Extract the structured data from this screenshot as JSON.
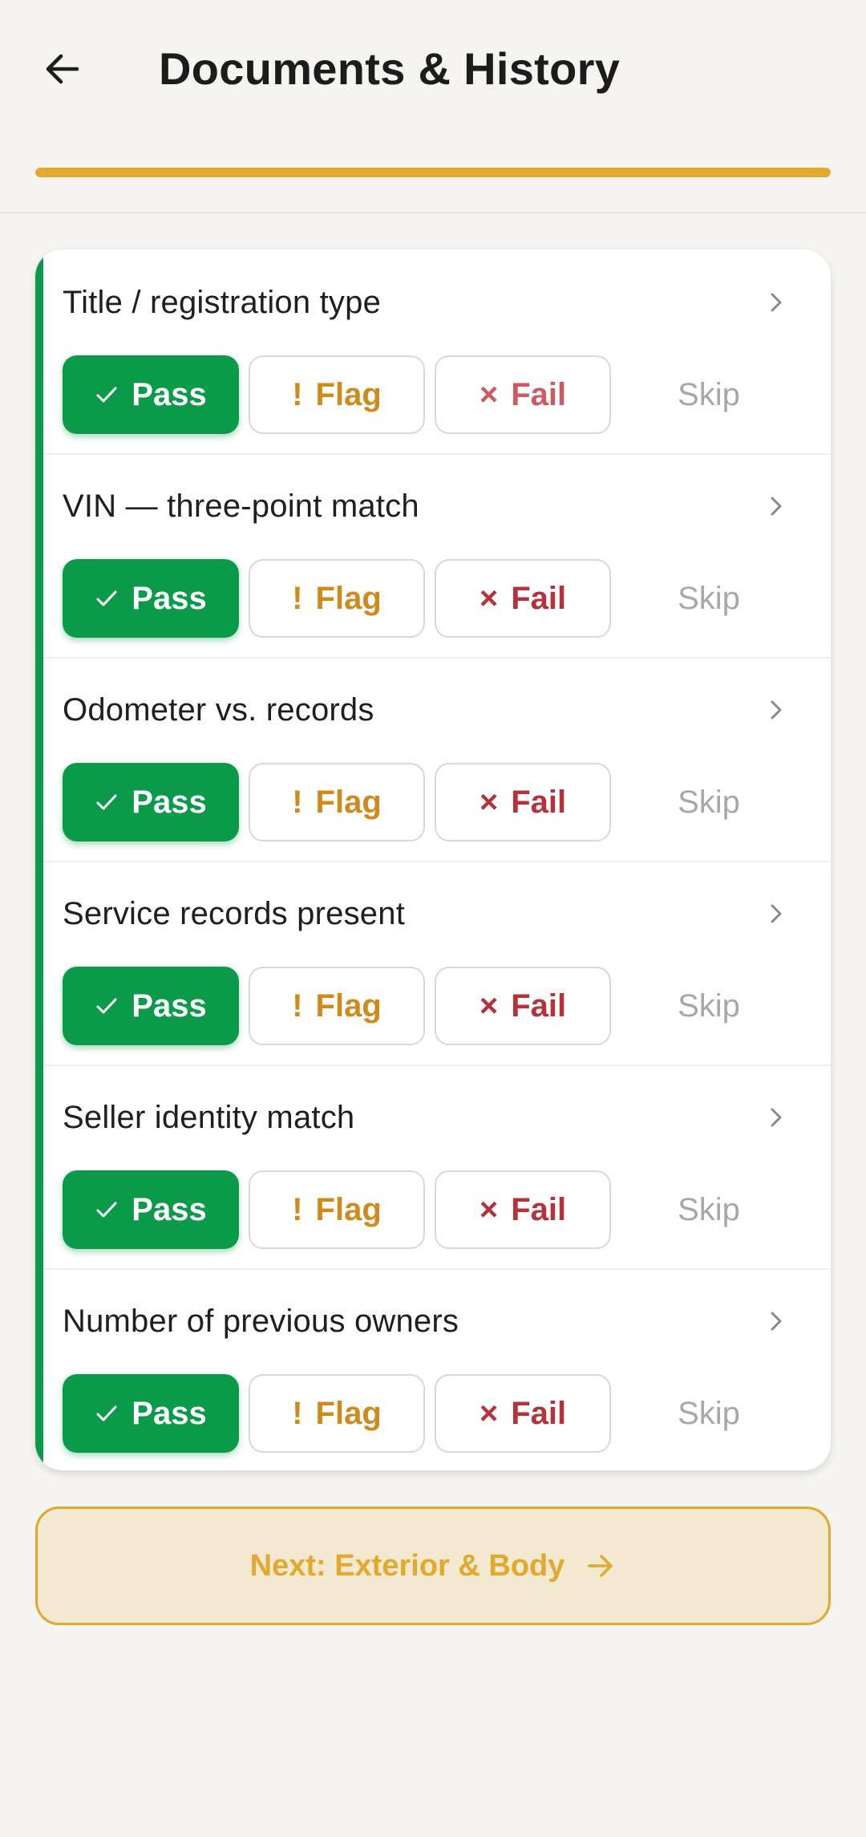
{
  "header": {
    "title": "Documents & History",
    "back_icon": "arrow-left-icon",
    "progress_fraction": 1.0,
    "progress_color": "#e2a92e"
  },
  "checklist": {
    "accent_color": "#0b9a4a",
    "items": [
      {
        "label": "Title / registration type",
        "selected": "pass",
        "pass_label": "Pass",
        "flag_label": "Flag",
        "fail_label": "Fail",
        "skip_label": "Skip",
        "flag_glyph": "!",
        "fail_glyph": "×"
      },
      {
        "label": "VIN — three-point match",
        "selected": "pass",
        "pass_label": "Pass",
        "flag_label": "Flag",
        "fail_label": "Fail",
        "skip_label": "Skip",
        "flag_glyph": "!",
        "fail_glyph": "×"
      },
      {
        "label": "Odometer vs. records",
        "selected": "pass",
        "pass_label": "Pass",
        "flag_label": "Flag",
        "fail_label": "Fail",
        "skip_label": "Skip",
        "flag_glyph": "!",
        "fail_glyph": "×"
      },
      {
        "label": "Service records present",
        "selected": "pass",
        "pass_label": "Pass",
        "flag_label": "Flag",
        "fail_label": "Fail",
        "skip_label": "Skip",
        "flag_glyph": "!",
        "fail_glyph": "×"
      },
      {
        "label": "Seller identity match",
        "selected": "pass",
        "pass_label": "Pass",
        "flag_label": "Flag",
        "fail_label": "Fail",
        "skip_label": "Skip",
        "flag_glyph": "!",
        "fail_glyph": "×"
      },
      {
        "label": "Number of previous owners",
        "selected": "pass",
        "pass_label": "Pass",
        "flag_label": "Flag",
        "fail_label": "Fail",
        "skip_label": "Skip",
        "flag_glyph": "!",
        "fail_glyph": "×"
      }
    ]
  },
  "footer": {
    "next_label": "Next: Exterior & Body",
    "next_icon": "arrow-right-icon"
  }
}
